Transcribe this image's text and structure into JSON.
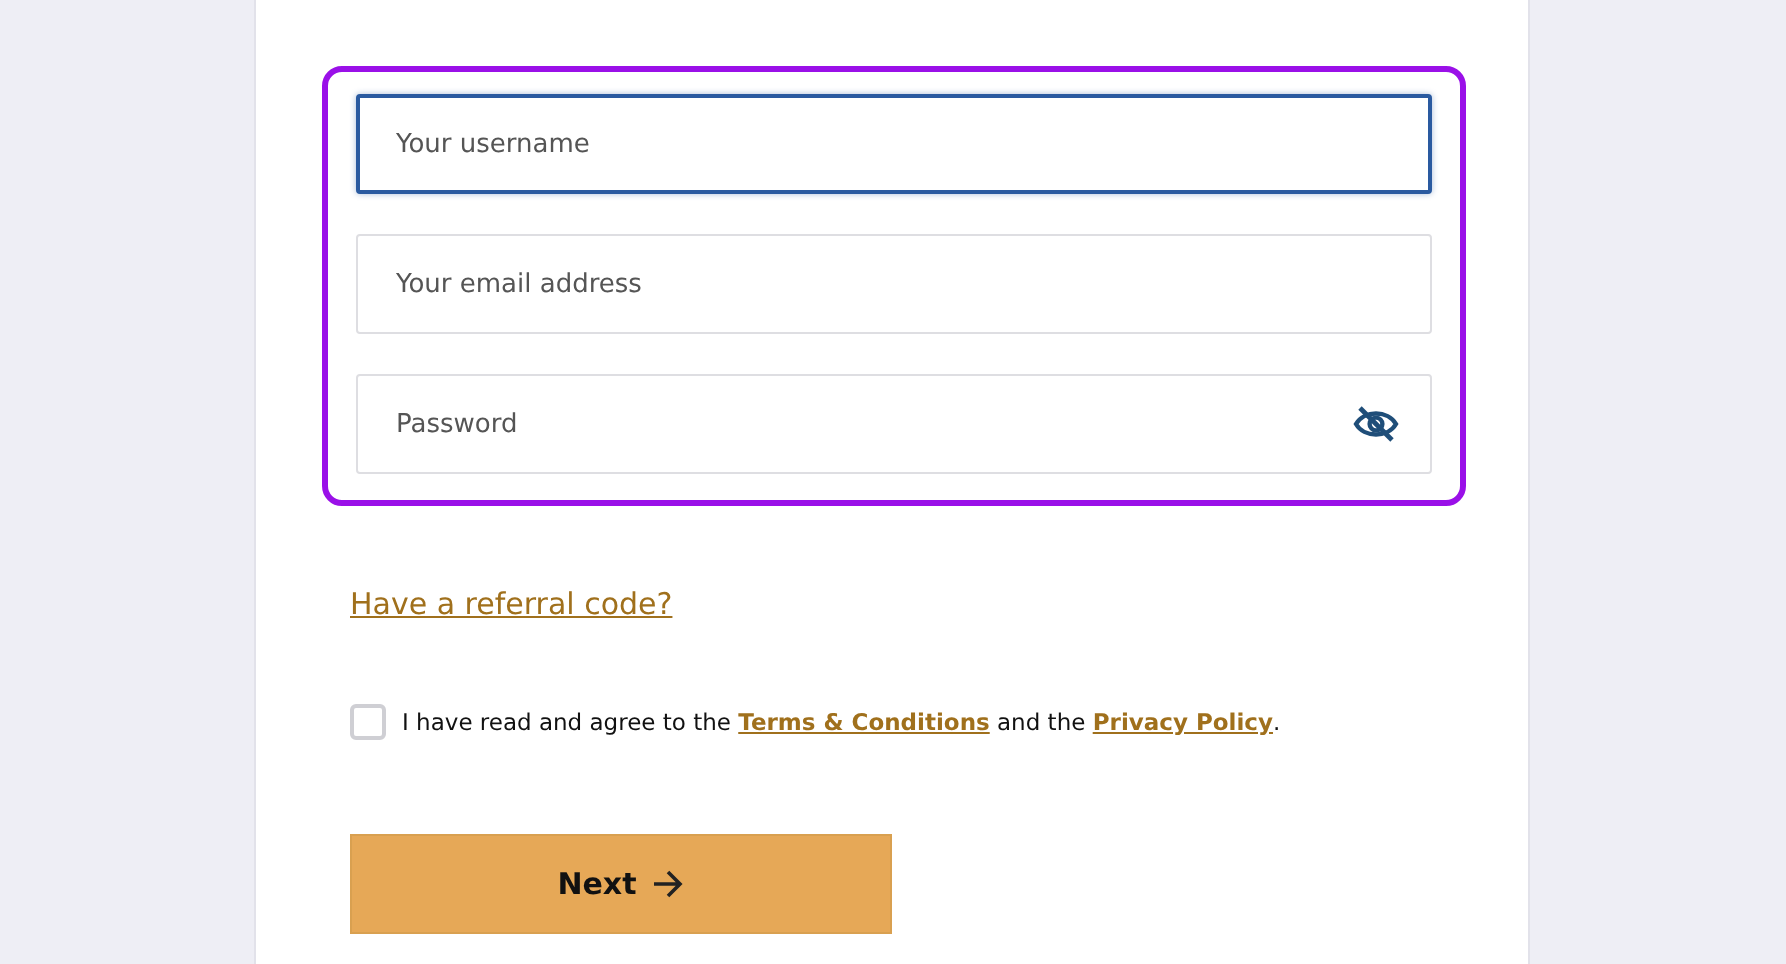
{
  "form": {
    "fields": [
      {
        "kind": "text",
        "placeholder": "Your username",
        "focused": true
      },
      {
        "kind": "email",
        "placeholder": "Your email address",
        "focused": false
      },
      {
        "kind": "password",
        "placeholder": "Password",
        "focused": false
      }
    ],
    "highlighted": true,
    "referral_link": "Have a referral code?",
    "agreement": {
      "checked": false,
      "before": "I have read and agree to the",
      "terms_link": "Terms & Conditions",
      "middle": "and the",
      "privacy_link": "Privacy Policy",
      "after": "."
    },
    "next_button": "Next"
  }
}
